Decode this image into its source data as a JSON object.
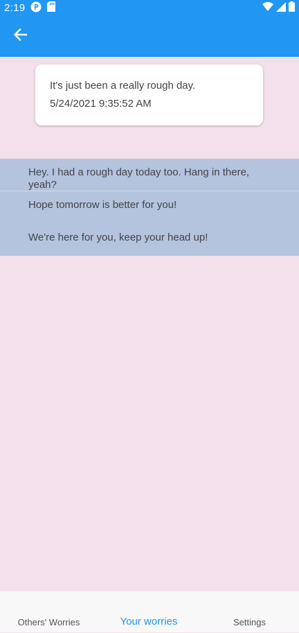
{
  "status_bar": {
    "time": "2:19",
    "icons": [
      "app-notification-icon",
      "sd-card-icon",
      "wifi-icon",
      "signal-icon",
      "battery-icon"
    ]
  },
  "app_bar": {
    "back_icon": "arrow-left-icon",
    "color": "#2196f3"
  },
  "worry": {
    "text": "It's just been a really rough day.",
    "date": "5/24/2021 9:35:52 AM"
  },
  "responses": [
    {
      "text": "Hey. I had a rough day today too. Hang in there, yeah?"
    },
    {
      "text": "Hope tomorrow is better for you!"
    },
    {
      "text": "We're here for you, keep your head up!"
    }
  ],
  "bottom_nav": {
    "items": [
      {
        "label": "Others' Worries",
        "active": false
      },
      {
        "label": "Your worries",
        "active": true
      },
      {
        "label": "Settings",
        "active": false
      }
    ]
  },
  "colors": {
    "accent": "#2196f3",
    "background": "#f3e0ea",
    "responses_bg": "#b4c3de"
  }
}
